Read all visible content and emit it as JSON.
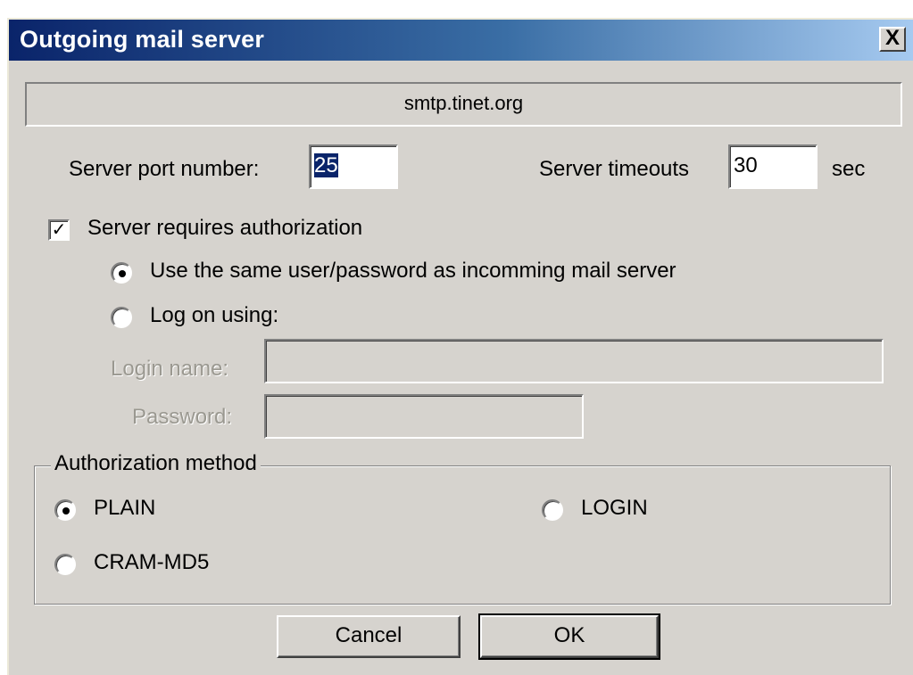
{
  "window": {
    "title": "Outgoing mail server",
    "close_glyph": "X"
  },
  "server": {
    "host": "smtp.tinet.org"
  },
  "port": {
    "label": "Server port number:",
    "value": "25"
  },
  "timeout": {
    "label": "Server timeouts",
    "value": "30",
    "unit": "sec"
  },
  "auth": {
    "requires_label": "Server requires authorization",
    "requires_checked": true,
    "same_user_label": "Use the same user/password as incomming mail server",
    "same_user_selected": true,
    "logon_label": "Log on using:",
    "logon_selected": false,
    "login_name_label": "Login name:",
    "login_name_value": "",
    "password_label": "Password:",
    "password_value": ""
  },
  "method": {
    "group_label": "Authorization method",
    "options": [
      {
        "label": "PLAIN",
        "selected": true
      },
      {
        "label": "LOGIN",
        "selected": false
      },
      {
        "label": "CRAM-MD5",
        "selected": false
      }
    ]
  },
  "buttons": {
    "cancel": "Cancel",
    "ok": "OK"
  },
  "colors": {
    "dialog_bg": "#d6d3ce",
    "title_start": "#0a246a",
    "title_end": "#a6caf0",
    "selection": "#0a246a"
  }
}
